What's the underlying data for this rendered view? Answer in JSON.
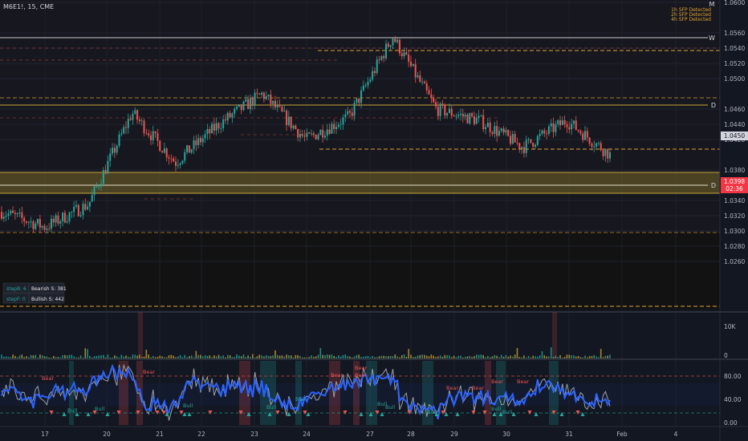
{
  "symbol": "M6E1!, 15, CME",
  "sfp_alerts": [
    "1h SFP Detected",
    "2h SFP Detected",
    "4h SFP Detected"
  ],
  "price_axis": {
    "ticks": [
      "1.0600",
      "1.0560",
      "1.0540",
      "1.0520",
      "1.0500",
      "1.0460",
      "1.0440",
      "1.0420",
      "1.0380",
      "1.0360",
      "1.0340",
      "1.0320",
      "1.0300",
      "1.0280",
      "1.0260"
    ],
    "crosshair_label": "1.0450",
    "current_price": "1.0398",
    "countdown": "02:36"
  },
  "level_tags": [
    "M",
    "W",
    "D",
    "D"
  ],
  "volume_axis": [
    "10K",
    "0"
  ],
  "osc_axis": [
    "80.00",
    "40.00",
    "0.00"
  ],
  "time_axis": [
    "17",
    "20",
    "21",
    "22",
    "23",
    "24",
    "27",
    "28",
    "29",
    "30",
    "31",
    "Feb",
    "4"
  ],
  "info_table": [
    {
      "left": "stepB: 6",
      "right": "Bearish S: 381"
    },
    {
      "left": "stepF: 0",
      "right": "Bullish S: 442"
    }
  ],
  "osc_labels": {
    "bear": "Bear",
    "bull": "Bull"
  },
  "colors": {
    "background": "#131722",
    "up": "#26a69a",
    "down": "#ef5350",
    "zone": "#b89a2a",
    "level_orange": "#e0a030",
    "osc_line": "#2962ff",
    "price_tag": "#f23645"
  },
  "chart_data": {
    "type": "line",
    "title": "M6E1!, 15, CME",
    "xlabel": "",
    "ylabel": "",
    "ylim": [
      1.025,
      1.0605
    ],
    "x": [
      "17",
      "20",
      "21",
      "22",
      "23",
      "24",
      "27",
      "28",
      "29",
      "30",
      "31"
    ],
    "series": [
      {
        "values": [
          1.0325,
          1.0305,
          1.0335,
          1.0455,
          1.039,
          1.044,
          1.048,
          1.042,
          1.045,
          1.0555,
          1.046,
          1.0445,
          1.041,
          1.0445,
          1.04
        ]
      }
    ],
    "levels": [
      {
        "label": "W",
        "value": 1.0558
      },
      {
        "label": "D",
        "value": 1.0485
      },
      {
        "label": "D",
        "value": 1.0393
      }
    ],
    "zone": [
      1.0384,
      1.041
    ]
  }
}
